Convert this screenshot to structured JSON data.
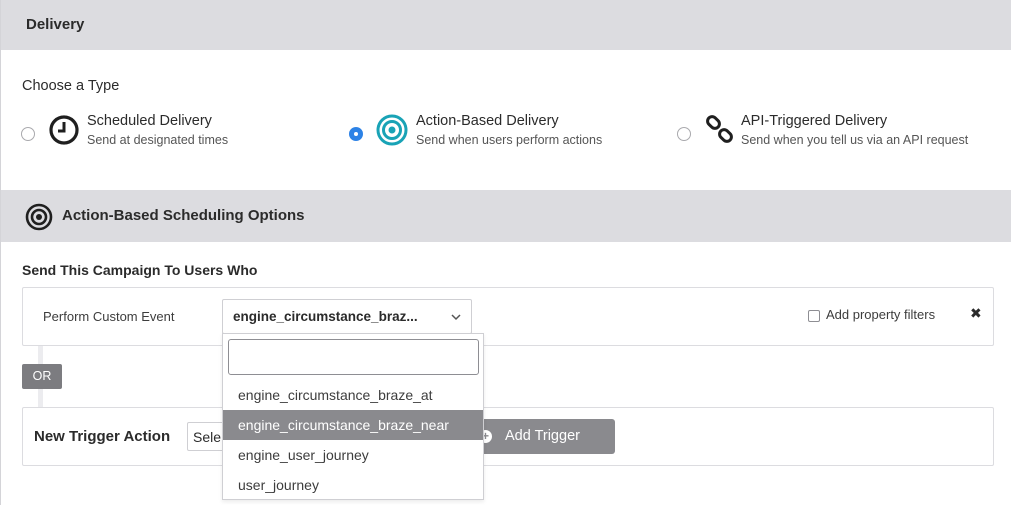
{
  "delivery": {
    "header": "Delivery",
    "choose_label": "Choose a Type",
    "options": [
      {
        "title": "Scheduled Delivery",
        "subtitle": "Send at designated times",
        "icon": "clock-icon",
        "selected": false
      },
      {
        "title": "Action-Based Delivery",
        "subtitle": "Send when users perform actions",
        "icon": "target-icon",
        "selected": true
      },
      {
        "title": "API-Triggered Delivery",
        "subtitle": "Send when you tell us via an API request",
        "icon": "link-icon",
        "selected": false
      }
    ]
  },
  "scheduling": {
    "header": "Action-Based Scheduling Options",
    "send_label": "Send This Campaign To Users Who",
    "trigger": {
      "action_label": "Perform Custom Event",
      "selected_event": "engine_circumstance_braz...",
      "property_filters_label": "Add property filters",
      "close": "✖"
    },
    "or_label": "OR",
    "new_trigger": {
      "label": "New Trigger Action",
      "select_value": "Sele",
      "add_button": "Add Trigger"
    },
    "dropdown": {
      "search_value": "",
      "items": [
        "engine_circumstance_braze_at",
        "engine_circumstance_braze_near",
        "engine_user_journey",
        "user_journey"
      ],
      "highlighted": "engine_circumstance_braze_near"
    }
  },
  "colors": {
    "header_bg": "#dcdce0",
    "accent": "#2d82e6",
    "teal": "#19a3b6",
    "button_gray": "#8a8a8e"
  }
}
